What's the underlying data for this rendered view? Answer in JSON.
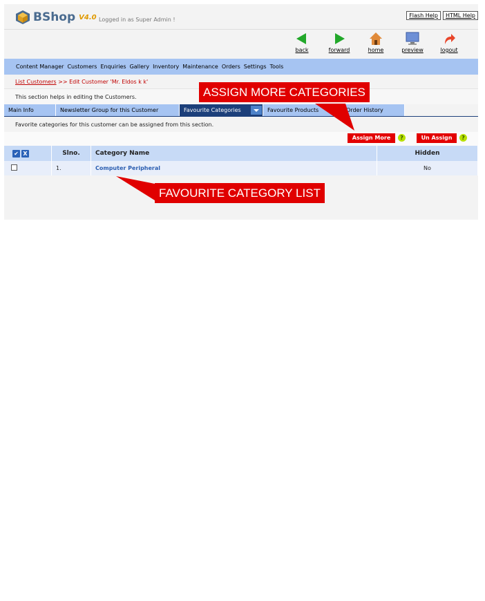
{
  "app": {
    "name": "BShop",
    "version": "V4.0",
    "logged_in": "Logged in as Super Admin !",
    "flash_help": "Flash Help",
    "html_help": "HTML Help"
  },
  "nav": {
    "back": "back",
    "forward": "forward",
    "home": "home",
    "preview": "preview",
    "logout": "logout"
  },
  "menu": [
    "Content Manager",
    "Customers",
    "Enquiries",
    "Gallery",
    "Inventory",
    "Maintenance",
    "Orders",
    "Settings",
    "Tools"
  ],
  "breadcrumb": {
    "link": "List Customers",
    "sep": ">>",
    "current": "Edit Customer 'Mr. Eldos k k'"
  },
  "section_help": "This section helps in editing the Customers.",
  "tabs": [
    "Main Info",
    "Newsletter Group for this Customer",
    "Favourite Categories",
    "Favourite Products",
    "Order History"
  ],
  "info": "Favorite categories for this customer can be assigned from this section.",
  "actions": {
    "assign_more": "Assign More",
    "un_assign": "Un Assign",
    "help": "?"
  },
  "table": {
    "headers": {
      "slno": "Slno.",
      "category": "Category Name",
      "hidden": "Hidden"
    },
    "check_all": "✔",
    "uncheck_all": "X",
    "rows": [
      {
        "slno": "1.",
        "category": "Computer Peripheral",
        "hidden": "No"
      }
    ]
  },
  "callouts": {
    "assign_more": "ASSIGN MORE CATEGORIES",
    "favourite_list": "FAVOURITE CATEGORY LIST"
  },
  "colors": {
    "accent_blue": "#a6c4f2",
    "active_tab": "#1c3f7a",
    "action_red": "#e30000"
  }
}
